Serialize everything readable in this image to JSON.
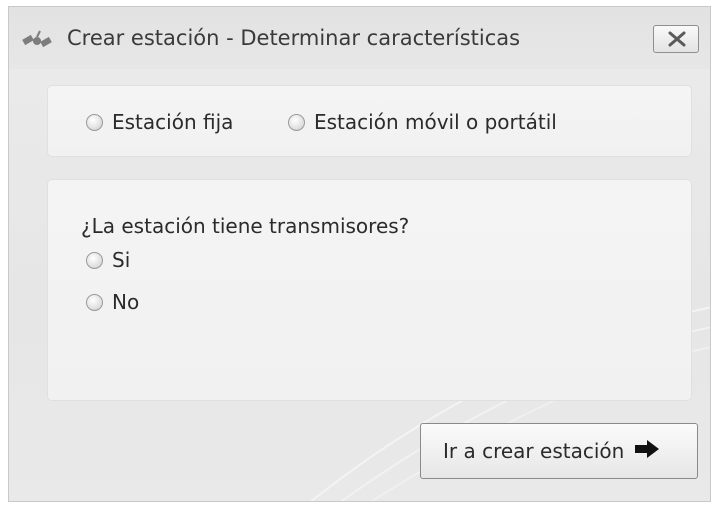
{
  "window": {
    "title": "Crear estación - Determinar características",
    "close_icon": "close-icon",
    "app_icon": "satellite-icon"
  },
  "station_type": {
    "options": [
      {
        "label": "Estación fija",
        "selected": false
      },
      {
        "label": "Estación móvil o portátil",
        "selected": false
      }
    ]
  },
  "transmitters": {
    "question": "¿La estación tiene transmisores?",
    "options": [
      {
        "label": "Si",
        "selected": false
      },
      {
        "label": "No",
        "selected": false
      }
    ]
  },
  "actions": {
    "go_label": "Ir a crear estación",
    "go_icon": "arrow-right-icon"
  },
  "colors": {
    "window_bg": "#e8e8e8",
    "panel_bg": "#f3f3f3",
    "text": "#2b2b2b"
  }
}
